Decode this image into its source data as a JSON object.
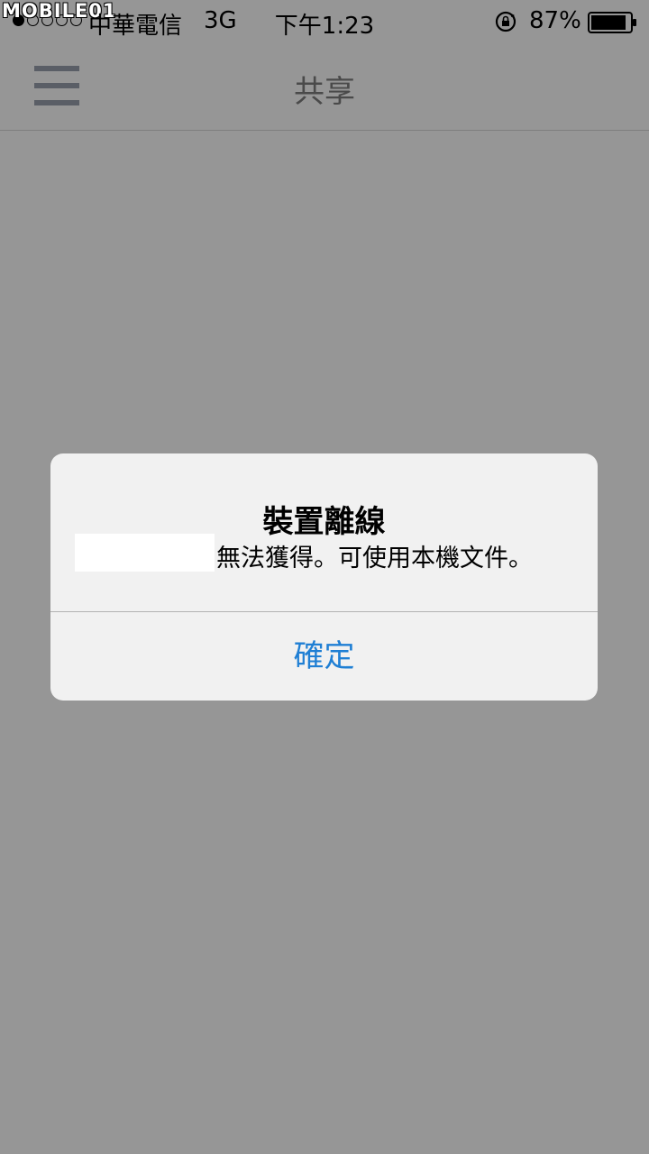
{
  "status_bar": {
    "watermark": "MOBILE01",
    "carrier": "中華電信",
    "network": "3G",
    "time": "下午1:23",
    "battery_percent": "87%"
  },
  "nav": {
    "title": "共享"
  },
  "alert": {
    "title": "裝置離線",
    "message": "無法獲得。可使用本機文件。",
    "ok_label": "確定",
    "ok_color": "#1f7fd4"
  },
  "colors": {
    "background": "#969696",
    "alert_bg": "#f1f1f1"
  }
}
